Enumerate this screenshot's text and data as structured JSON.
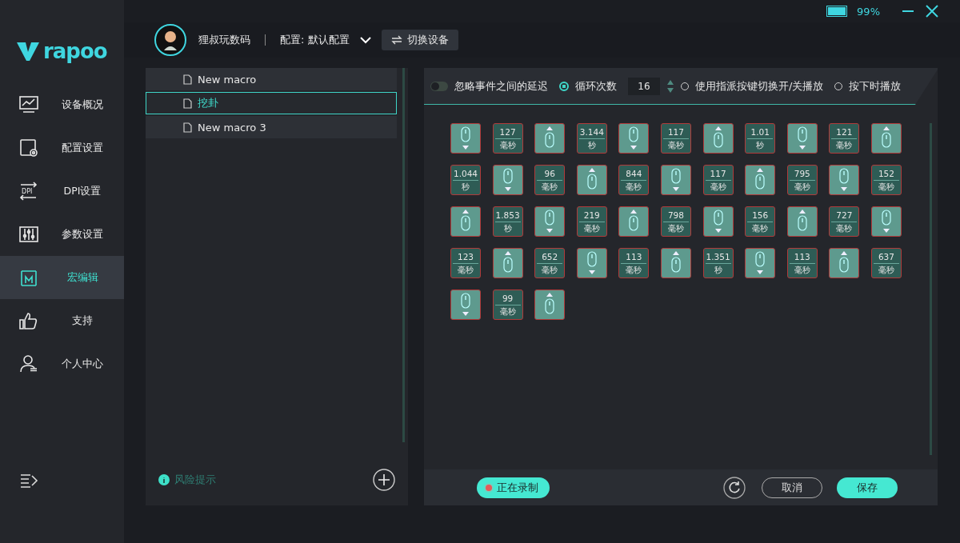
{
  "brand": {
    "name": "rapoo"
  },
  "window": {
    "battery": "99%"
  },
  "header": {
    "user": "狸叔玩数码",
    "profile": "配置: 默认配置",
    "switch_button": "切换设备"
  },
  "sidebar": {
    "items": [
      {
        "label": "设备概况",
        "kind": "monitor",
        "selected": false
      },
      {
        "label": "配置设置",
        "kind": "config",
        "selected": false
      },
      {
        "label": "DPI设置",
        "kind": "dpi",
        "icon_text": "DPI",
        "selected": false
      },
      {
        "label": "参数设置",
        "kind": "sliders",
        "selected": false
      },
      {
        "label": "宏编辑",
        "kind": "macro",
        "selected": true
      },
      {
        "label": "支持",
        "kind": "thumb",
        "selected": false
      },
      {
        "label": "个人中心",
        "kind": "user",
        "selected": false
      }
    ]
  },
  "macros": {
    "items": [
      {
        "label": "New macro",
        "selected": false
      },
      {
        "label": "挖卦",
        "selected": true
      },
      {
        "label": "New macro 3",
        "selected": false
      }
    ],
    "risk_hint": "风险提示"
  },
  "options": {
    "ignore_delay": {
      "label": "忽略事件之间的延迟",
      "on": false
    },
    "modes": [
      {
        "label": "循环次数",
        "selected": true,
        "count": "16"
      },
      {
        "label": "使用指派按键切换开/关播放",
        "selected": false
      },
      {
        "label": "按下时播放",
        "selected": false
      }
    ]
  },
  "events": [
    {
      "kind": "down"
    },
    {
      "kind": "delay",
      "value": "127",
      "unit": "毫秒"
    },
    {
      "kind": "up"
    },
    {
      "kind": "delay",
      "value": "3.144",
      "unit": "秒"
    },
    {
      "kind": "down"
    },
    {
      "kind": "delay",
      "value": "117",
      "unit": "毫秒"
    },
    {
      "kind": "up"
    },
    {
      "kind": "delay",
      "value": "1.01",
      "unit": "秒"
    },
    {
      "kind": "down"
    },
    {
      "kind": "delay",
      "value": "121",
      "unit": "毫秒"
    },
    {
      "kind": "up"
    },
    {
      "kind": "delay",
      "value": "1.044",
      "unit": "秒"
    },
    {
      "kind": "down"
    },
    {
      "kind": "delay",
      "value": "96",
      "unit": "毫秒"
    },
    {
      "kind": "up"
    },
    {
      "kind": "delay",
      "value": "844",
      "unit": "毫秒"
    },
    {
      "kind": "down"
    },
    {
      "kind": "delay",
      "value": "117",
      "unit": "毫秒"
    },
    {
      "kind": "up"
    },
    {
      "kind": "delay",
      "value": "795",
      "unit": "毫秒"
    },
    {
      "kind": "down"
    },
    {
      "kind": "delay",
      "value": "152",
      "unit": "毫秒"
    },
    {
      "kind": "up"
    },
    {
      "kind": "delay",
      "value": "1.853",
      "unit": "秒"
    },
    {
      "kind": "down"
    },
    {
      "kind": "delay",
      "value": "219",
      "unit": "毫秒"
    },
    {
      "kind": "up"
    },
    {
      "kind": "delay",
      "value": "798",
      "unit": "毫秒"
    },
    {
      "kind": "down"
    },
    {
      "kind": "delay",
      "value": "156",
      "unit": "毫秒"
    },
    {
      "kind": "up"
    },
    {
      "kind": "delay",
      "value": "727",
      "unit": "毫秒"
    },
    {
      "kind": "down"
    },
    {
      "kind": "delay",
      "value": "123",
      "unit": "毫秒"
    },
    {
      "kind": "up"
    },
    {
      "kind": "delay",
      "value": "652",
      "unit": "毫秒"
    },
    {
      "kind": "down"
    },
    {
      "kind": "delay",
      "value": "113",
      "unit": "毫秒"
    },
    {
      "kind": "up"
    },
    {
      "kind": "delay",
      "value": "1.351",
      "unit": "秒"
    },
    {
      "kind": "down"
    },
    {
      "kind": "delay",
      "value": "113",
      "unit": "毫秒"
    },
    {
      "kind": "up"
    },
    {
      "kind": "delay",
      "value": "637",
      "unit": "毫秒"
    },
    {
      "kind": "down"
    },
    {
      "kind": "delay",
      "value": "99",
      "unit": "毫秒"
    },
    {
      "kind": "up"
    }
  ],
  "footer": {
    "record_button": "正在录制",
    "recording": true,
    "cancel_button": "取消",
    "save_button": "保存"
  }
}
